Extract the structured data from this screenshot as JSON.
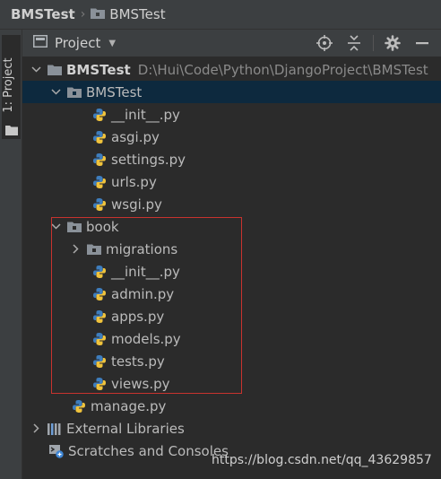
{
  "breadcrumb": {
    "root": "BMSTest",
    "child": "BMSTest"
  },
  "side_panel": {
    "tab_label": "1: Project"
  },
  "toolbar": {
    "title": "Project"
  },
  "tree": {
    "root": {
      "label": "BMSTest",
      "path": "D:\\Hui\\Code\\Python\\DjangoProject\\BMSTest"
    },
    "pkg": {
      "label": "BMSTest",
      "files": [
        "__init__.py",
        "asgi.py",
        "settings.py",
        "urls.py",
        "wsgi.py"
      ]
    },
    "book": {
      "label": "book",
      "migrations": "migrations",
      "files": [
        "__init__.py",
        "admin.py",
        "apps.py",
        "models.py",
        "tests.py",
        "views.py"
      ]
    },
    "manage": "manage.py",
    "external_libraries": "External Libraries",
    "scratches": "Scratches and Consoles"
  },
  "watermark": "https://blog.csdn.net/qq_43629857",
  "colors": {
    "selection": "#0d293e",
    "highlight_border": "#c8332e",
    "folder": "#8a9199",
    "python_blue": "#3e7dbd",
    "python_yellow": "#f0c33c"
  }
}
